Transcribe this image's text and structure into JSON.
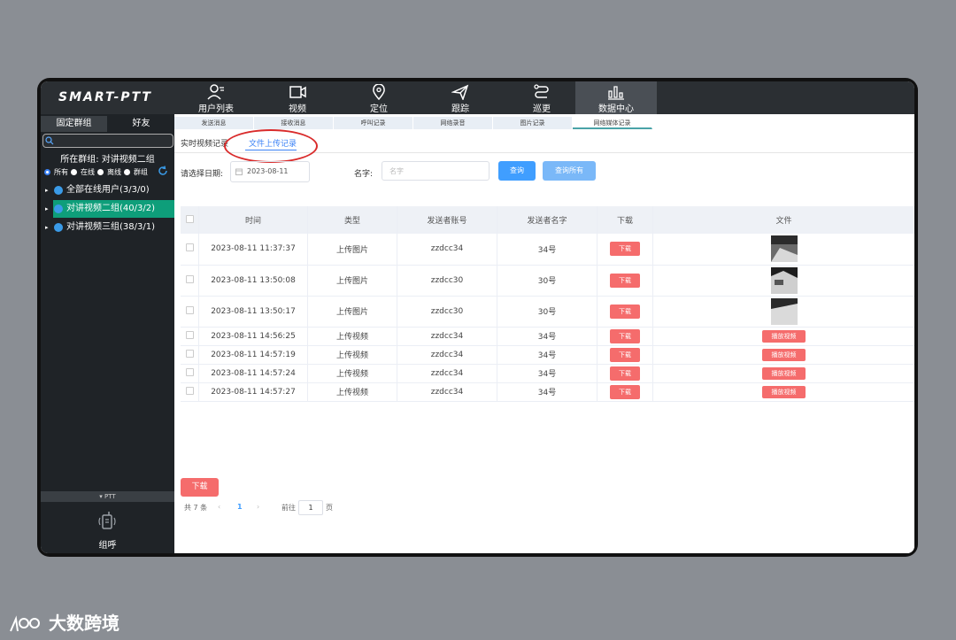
{
  "app": {
    "logo": "SMART-PTT"
  },
  "nav": [
    {
      "label": "用户列表",
      "icon": "user-list-icon"
    },
    {
      "label": "视频",
      "icon": "video-icon"
    },
    {
      "label": "定位",
      "icon": "location-pin-icon"
    },
    {
      "label": "跟踪",
      "icon": "send-icon"
    },
    {
      "label": "巡更",
      "icon": "route-icon"
    },
    {
      "label": "数据中心",
      "icon": "bar-chart-icon",
      "active": true
    }
  ],
  "sidebar": {
    "tabs": [
      "固定群组",
      "好友"
    ],
    "group_prefix": "所在群组:",
    "group_name": "对讲视频二组",
    "filters": [
      "所有",
      "在线",
      "离线",
      "群组"
    ],
    "tree": [
      {
        "label": "全部在线用户(3/3/0)"
      },
      {
        "label": "对讲视频二组(40/3/2)",
        "active": true
      },
      {
        "label": "对讲视频三组(38/3/1)"
      }
    ],
    "ptt_label": "▾ PTT",
    "call_label": "组呼"
  },
  "subtabs": [
    "发送消息",
    "接收消息",
    "呼叫记录",
    "网络录音",
    "图片记录",
    "网络媒体记录"
  ],
  "record_tabs": [
    "实时视频记录",
    "文件上传记录"
  ],
  "filter": {
    "date_label": "请选择日期:",
    "date_value": "2023-08-11",
    "name_label": "名字:",
    "name_placeholder": "名字",
    "query_btn": "查询",
    "query_all_btn": "查询所有"
  },
  "table": {
    "headers": [
      "时间",
      "类型",
      "发送者账号",
      "发送者名字",
      "下载",
      "文件"
    ],
    "rows": [
      {
        "time": "2023-08-11 11:37:37",
        "type": "上传图片",
        "account": "zzdcc34",
        "name": "34号",
        "download": "下载",
        "file": "image"
      },
      {
        "time": "2023-08-11 13:50:08",
        "type": "上传图片",
        "account": "zzdcc30",
        "name": "30号",
        "download": "下载",
        "file": "image"
      },
      {
        "time": "2023-08-11 13:50:17",
        "type": "上传图片",
        "account": "zzdcc30",
        "name": "30号",
        "download": "下载",
        "file": "image"
      },
      {
        "time": "2023-08-11 14:56:25",
        "type": "上传视频",
        "account": "zzdcc34",
        "name": "34号",
        "download": "下载",
        "file": "播放视频"
      },
      {
        "time": "2023-08-11 14:57:19",
        "type": "上传视频",
        "account": "zzdcc34",
        "name": "34号",
        "download": "下载",
        "file": "播放视频"
      },
      {
        "time": "2023-08-11 14:57:24",
        "type": "上传视频",
        "account": "zzdcc34",
        "name": "34号",
        "download": "下载",
        "file": "播放视频"
      },
      {
        "time": "2023-08-11 14:57:27",
        "type": "上传视频",
        "account": "zzdcc34",
        "name": "34号",
        "download": "下载",
        "file": "播放视频"
      }
    ]
  },
  "bulk_download": "下载",
  "pager": {
    "total": "共 7 条",
    "prev": "‹",
    "page": "1",
    "next": "›",
    "goto": "前往",
    "goto_value": "1",
    "unit": "页"
  },
  "watermark": "大数跨境",
  "colors": {
    "accent": "#409eff",
    "danger": "#f56c6c",
    "active_group": "#0e9e7a",
    "annotation": "#d92b2b"
  }
}
